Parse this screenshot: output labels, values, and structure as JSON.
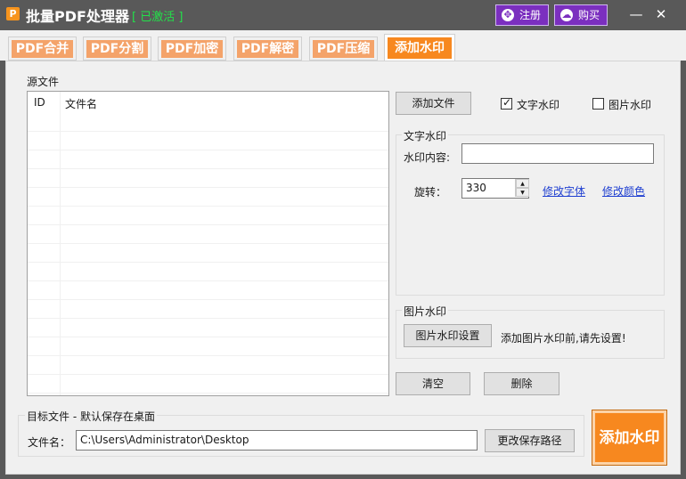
{
  "app": {
    "icon_letter": "P",
    "title": "批量PDF处理器",
    "status": "[ 已激活 ]",
    "register_label": "注册",
    "buy_label": "购买",
    "minimize": "—",
    "close": "✕"
  },
  "tabs": [
    {
      "label": "PDF合并"
    },
    {
      "label": "PDF分割"
    },
    {
      "label": "PDF加密"
    },
    {
      "label": "PDF解密"
    },
    {
      "label": "PDF压缩"
    },
    {
      "label": "添加水印",
      "active": true
    }
  ],
  "source": {
    "group_label": "源文件",
    "columns": [
      "ID",
      "文件名"
    ],
    "add_file_label": "添加文件",
    "text_watermark_checkbox": {
      "label": "文字水印",
      "checked": true
    },
    "image_watermark_checkbox": {
      "label": "图片水印",
      "checked": false
    },
    "clear_label": "清空",
    "delete_label": "删除"
  },
  "text_watermark": {
    "group_label": "文字水印",
    "content_label": "水印内容:",
    "content_value": "",
    "rotate_label": "旋转：",
    "rotate_value": "330",
    "change_font": "修改字体",
    "change_color": "修改颜色"
  },
  "image_watermark": {
    "group_label": "图片水印",
    "settings_label": "图片水印设置",
    "hint": "添加图片水印前,请先设置!"
  },
  "target": {
    "group_label": "目标文件 - 默认保存在桌面",
    "file_name_label": "文件名：",
    "path_value": "C:\\Users\\Administrator\\Desktop",
    "change_path_label": "更改保存路径"
  },
  "action": {
    "add_watermark_label": "添加水印"
  },
  "colors": {
    "titlebar": "#595959",
    "accent_orange": "#f7881f",
    "tab_orange": "#f4a36a",
    "activated_green": "#23e04a",
    "purple_button": "#7b2fbf",
    "link_blue": "#1f3fd1"
  }
}
